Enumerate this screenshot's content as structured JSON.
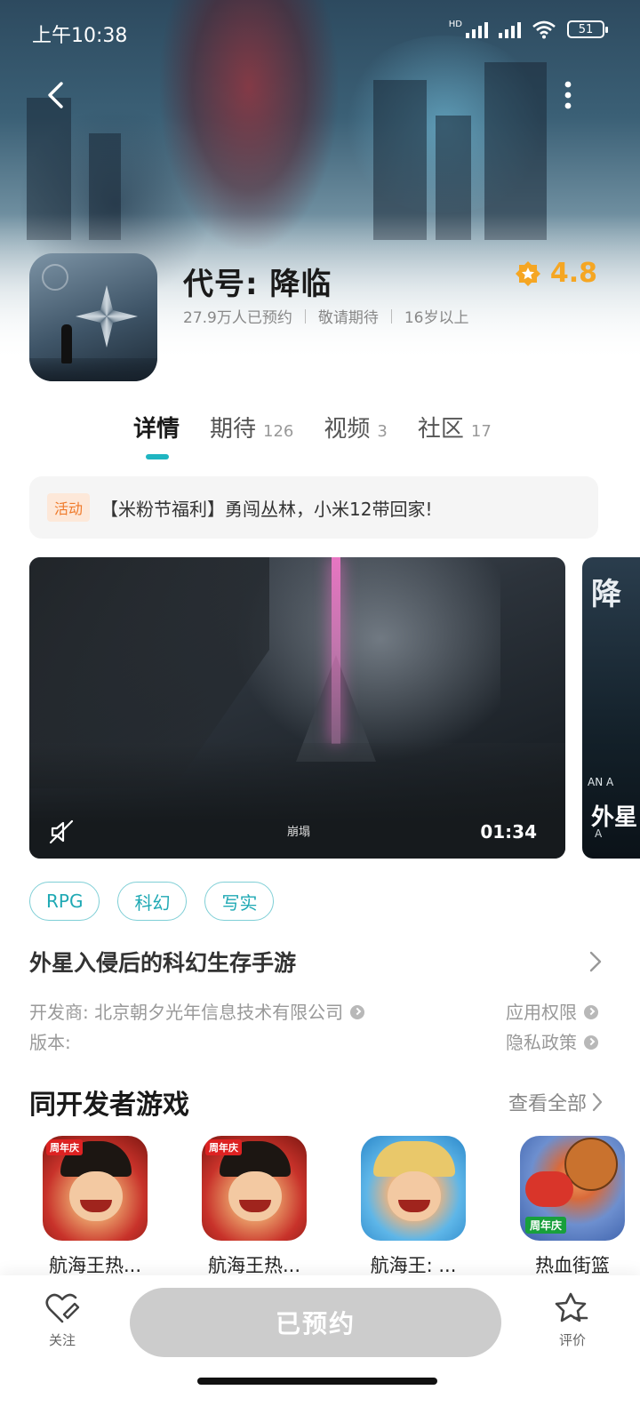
{
  "status_bar": {
    "time": "上午10:38",
    "hd_label": "HD",
    "battery": "51"
  },
  "game": {
    "title": "代号: 降临",
    "reservations": "27.9万人已预约",
    "release": "敬请期待",
    "age": "16岁以上",
    "rating": "4.8"
  },
  "tabs": [
    {
      "label": "详情",
      "count": ""
    },
    {
      "label": "期待",
      "count": "126"
    },
    {
      "label": "视频",
      "count": "3"
    },
    {
      "label": "社区",
      "count": "17"
    }
  ],
  "activity": {
    "badge": "活动",
    "text": "【米粉节福利】勇闯丛林，小米12带回家!"
  },
  "media": {
    "video_caption": "崩塌",
    "video_duration": "01:34",
    "screenshot_title": "降",
    "screenshot_sub": "AN A",
    "screenshot_big": "外星",
    "screenshot_small": "A"
  },
  "tags": [
    "RPG",
    "科幻",
    "写实"
  ],
  "description": "外星入侵后的科幻生存手游",
  "info": {
    "developer": "开发商: 北京朝夕光年信息技术有限公司",
    "version": "版本:",
    "permissions": "应用权限",
    "privacy": "隐私政策"
  },
  "same_dev": {
    "title": "同开发者游戏",
    "see_all": "查看全部",
    "games": [
      {
        "name": "航海王热...",
        "badge": "周年庆"
      },
      {
        "name": "航海王热...",
        "badge": "周年庆"
      },
      {
        "name": "航海王: ...",
        "badge": ""
      },
      {
        "name": "热血街篮",
        "badge": "周年庆"
      }
    ]
  },
  "bottom": {
    "follow_label": "关注",
    "reserve_label": "已预约",
    "review_label": "评价"
  }
}
